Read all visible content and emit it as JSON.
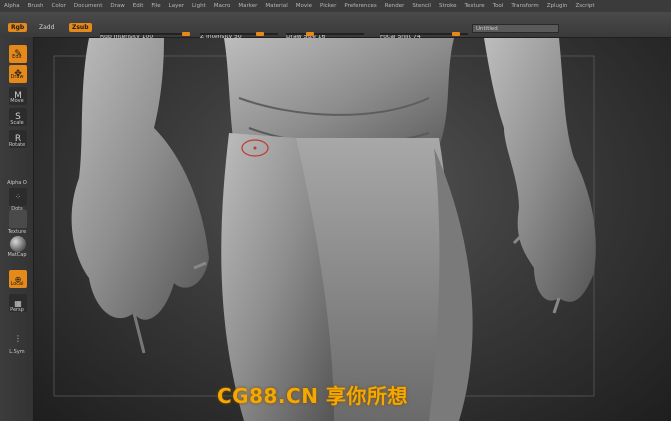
{
  "menubar": {
    "items": [
      "Alpha",
      "Brush",
      "Color",
      "Document",
      "Draw",
      "Edit",
      "File",
      "Layer",
      "Light",
      "Macro",
      "Marker",
      "Material",
      "Movie",
      "Picker",
      "Preferences",
      "Render",
      "Stencil",
      "Stroke",
      "Texture",
      "Tool",
      "Transform",
      "Zplugin",
      "Zscript"
    ]
  },
  "topshelf": {
    "rgb_label": "Rgb",
    "zadd_label": "Zadd",
    "zsub_label": "Zsub",
    "rgb_intensity": "Rgb Intensity 100",
    "z_intensity": "Z Intensity 50",
    "draw_size": "Draw Size 16",
    "focal_shift": "Focal Shift 74",
    "document_name": "Untitled"
  },
  "leftshelf": {
    "edit_label": "Edit",
    "draw_label": "Draw",
    "move_label": "Move",
    "scale_label": "Scale",
    "rotate_label": "Rotate",
    "alpha_label": "Alpha O",
    "dots_label": "Dots",
    "texture_label": "Texture",
    "matcap_label": "MatCap",
    "local_label": "Local",
    "persp_label": "Persp",
    "lsym_label": "L.Sym"
  },
  "watermark": {
    "text": "CG88.CN 享你所想"
  },
  "colors": {
    "accent": "#e58a1a",
    "watermark": "#f5a800"
  }
}
